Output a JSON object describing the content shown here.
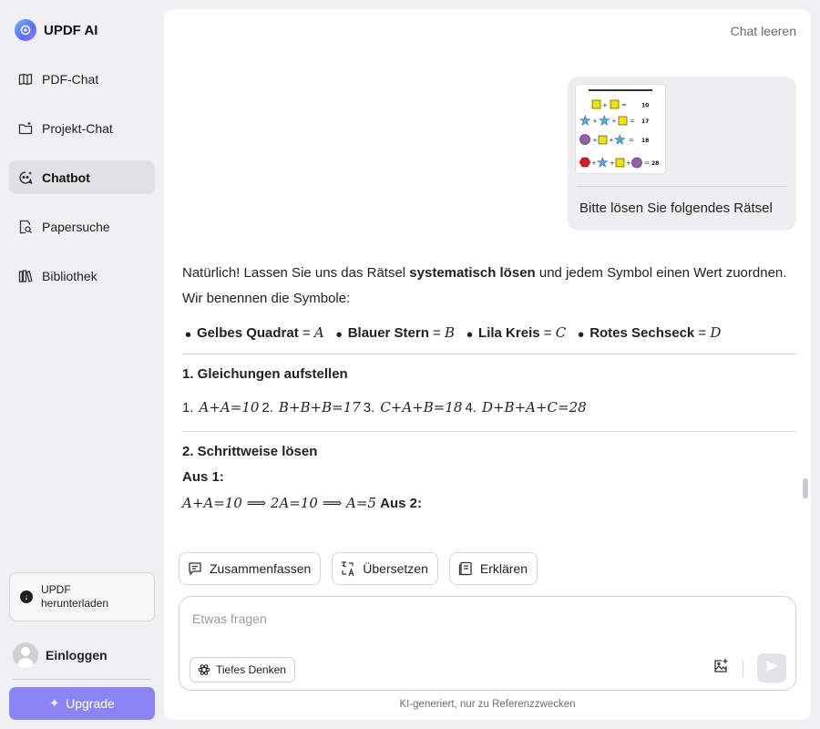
{
  "app": {
    "title": "UPDF AI",
    "accent": "#8c84f6"
  },
  "sidebar": {
    "items": [
      {
        "label": "PDF-Chat",
        "icon": "book-open-icon",
        "active": false
      },
      {
        "label": "Projekt-Chat",
        "icon": "folder-plus-icon",
        "active": false
      },
      {
        "label": "Chatbot",
        "icon": "chatbot-icon",
        "active": true
      },
      {
        "label": "Papersuche",
        "icon": "document-search-icon",
        "active": false
      },
      {
        "label": "Bibliothek",
        "icon": "library-icon",
        "active": false
      }
    ],
    "download_line1": "UPDF",
    "download_line2": "herunterladen",
    "login_label": "Einloggen",
    "upgrade_label": "Upgrade"
  },
  "header": {
    "clear_label": "Chat leeren"
  },
  "user_message": {
    "text": "Bitte lösen Sie folgendes Rätsel"
  },
  "answer": {
    "intro_before": "Natürlich! Lassen Sie uns das Rätsel ",
    "intro_bold": "systematisch lösen",
    "intro_after": " und jedem Symbol einen Wert zuordnen.",
    "intro2": "Wir benennen die Symbole:",
    "symbols": [
      {
        "name": "Gelbes Quadrat",
        "var": "A"
      },
      {
        "name": "Blauer Stern",
        "var": "B"
      },
      {
        "name": "Lila Kreis",
        "var": "C"
      },
      {
        "name": "Rotes Sechseck",
        "var": "D"
      }
    ],
    "section1": "1. Gleichungen aufstellen",
    "equations": [
      {
        "num": "1.",
        "eq": "A+A=10"
      },
      {
        "num": "2.",
        "eq": "B+B+B=17"
      },
      {
        "num": "3.",
        "eq": "C+A+B=18"
      },
      {
        "num": "4.",
        "eq": "D+B+A+C=28"
      }
    ],
    "section2": "2. Schrittweise lösen",
    "case1": "Aus 1:",
    "derivation": "A+A=10 ⟹ 2A=10 ⟹ A=5",
    "case2": "Aus 2:"
  },
  "actions": [
    {
      "label": "Zusammenfassen",
      "icon": "summarize-icon"
    },
    {
      "label": "Übersetzen",
      "icon": "translate-icon"
    },
    {
      "label": "Erklären",
      "icon": "explain-icon"
    }
  ],
  "composer": {
    "placeholder": "Etwas fragen",
    "deep_label": "Tiefes Denken"
  },
  "footer_note": "KI-generiert, nur zu Referenzzwecken"
}
